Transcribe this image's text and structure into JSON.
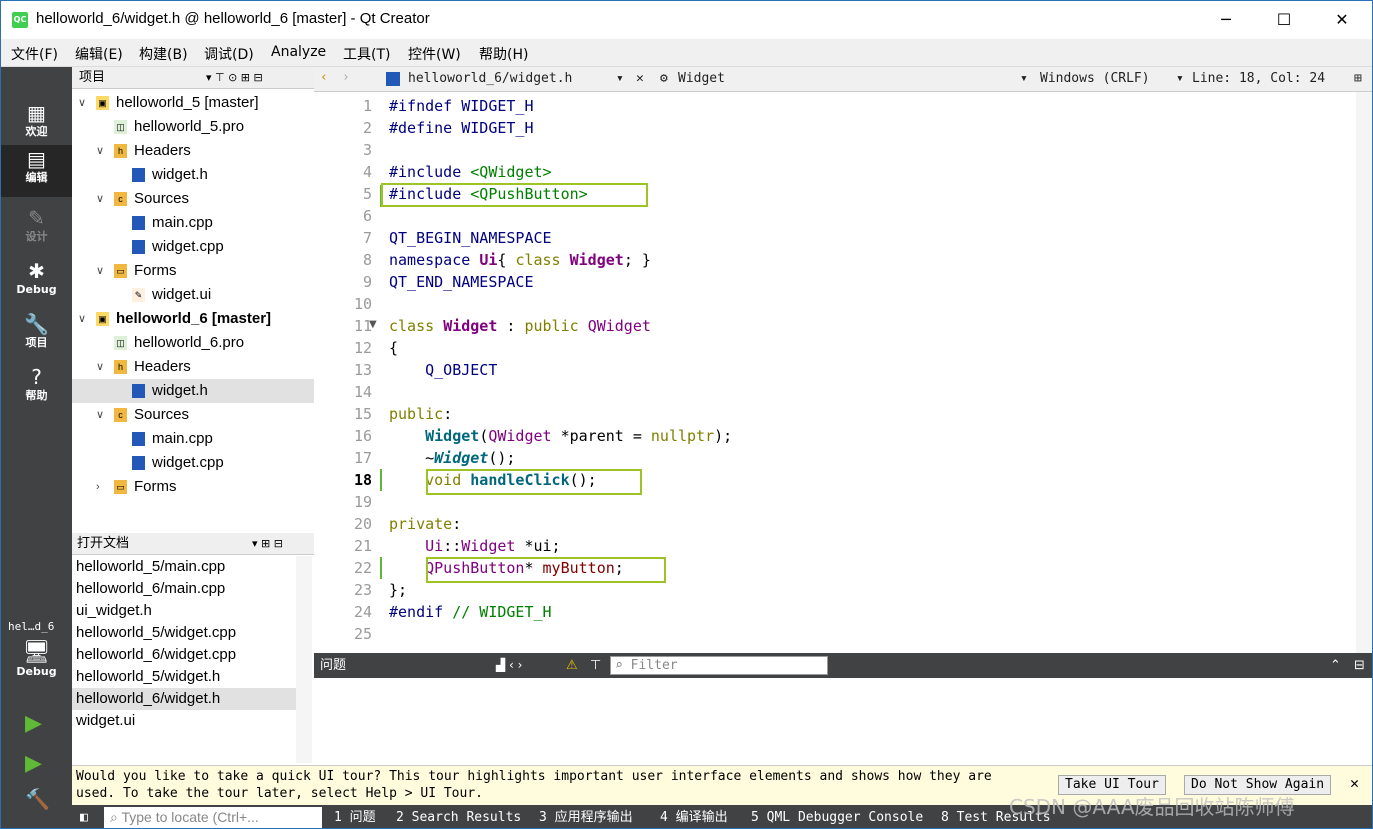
{
  "window": {
    "title": "helloworld_6/widget.h @ helloworld_6 [master] - Qt Creator",
    "logo": "QC",
    "minimize": "─",
    "maximize": "☐",
    "close": "✕"
  },
  "menu": [
    "文件(F)",
    "编辑(E)",
    "构建(B)",
    "调试(D)",
    "Analyze",
    "工具(T)",
    "控件(W)",
    "帮助(H)"
  ],
  "modes": [
    {
      "label": "欢迎",
      "icon": "▦"
    },
    {
      "label": "编辑",
      "icon": "▤"
    },
    {
      "label": "设计",
      "icon": "✎"
    },
    {
      "label": "Debug",
      "icon": "✱"
    },
    {
      "label": "项目",
      "icon": "🔧"
    },
    {
      "label": "帮助",
      "icon": "?"
    }
  ],
  "kit": {
    "name": "hel…d_6",
    "label": "Debug",
    "icon": "🖥"
  },
  "run_icons": [
    "▶",
    "▶",
    "🔨"
  ],
  "projects": {
    "header": "项目",
    "tree": [
      {
        "text": "helloworld_5 [master]",
        "level": 0,
        "arrow": "∨",
        "kind": "proj"
      },
      {
        "text": "helloworld_5.pro",
        "level": 1,
        "arrow": "",
        "kind": "pro"
      },
      {
        "text": "Headers",
        "level": 1,
        "arrow": "∨",
        "kind": "hfold"
      },
      {
        "text": "widget.h",
        "level": 2,
        "arrow": "",
        "kind": "h"
      },
      {
        "text": "Sources",
        "level": 1,
        "arrow": "∨",
        "kind": "cfold"
      },
      {
        "text": "main.cpp",
        "level": 2,
        "arrow": "",
        "kind": "cpp"
      },
      {
        "text": "widget.cpp",
        "level": 2,
        "arrow": "",
        "kind": "cpp"
      },
      {
        "text": "Forms",
        "level": 1,
        "arrow": "∨",
        "kind": "ffold"
      },
      {
        "text": "widget.ui",
        "level": 2,
        "arrow": "",
        "kind": "ui"
      },
      {
        "text": "helloworld_6 [master]",
        "level": 0,
        "arrow": "∨",
        "kind": "proj"
      },
      {
        "text": "helloworld_6.pro",
        "level": 1,
        "arrow": "",
        "kind": "pro"
      },
      {
        "text": "Headers",
        "level": 1,
        "arrow": "∨",
        "kind": "hfold"
      },
      {
        "text": "widget.h",
        "level": 2,
        "arrow": "",
        "kind": "h"
      },
      {
        "text": "Sources",
        "level": 1,
        "arrow": "∨",
        "kind": "cfold"
      },
      {
        "text": "main.cpp",
        "level": 2,
        "arrow": "",
        "kind": "cpp"
      },
      {
        "text": "widget.cpp",
        "level": 2,
        "arrow": "",
        "kind": "cpp"
      },
      {
        "text": "Forms",
        "level": 1,
        "arrow": "›",
        "kind": "ffold"
      }
    ]
  },
  "open_docs": {
    "header": "打开文档",
    "items": [
      "helloworld_5/main.cpp",
      "helloworld_6/main.cpp",
      "ui_widget.h",
      "helloworld_5/widget.cpp",
      "helloworld_6/widget.cpp",
      "helloworld_5/widget.h",
      "helloworld_6/widget.h",
      "widget.ui"
    ]
  },
  "editor": {
    "file": "helloworld_6/widget.h",
    "symbol": "Widget",
    "line_ending": "Windows (CRLF)",
    "position": "Line: 18, Col: 24",
    "lines": [
      [
        [
          "pp",
          "#ifndef WIDGET_H"
        ]
      ],
      [
        [
          "pp",
          "#define WIDGET_H"
        ]
      ],
      [],
      [
        [
          "pp",
          "#include "
        ],
        [
          "inc",
          "<QWidget>"
        ]
      ],
      [
        [
          "pp",
          "#include "
        ],
        [
          "inc",
          "<QPushButton>"
        ]
      ],
      [],
      [
        [
          "mac",
          "QT_BEGIN_NAMESPACE"
        ]
      ],
      [
        [
          "mac",
          "namespace "
        ],
        [
          "cl",
          "Ui"
        ],
        [
          "",
          "{ "
        ],
        [
          "kw",
          "class "
        ],
        [
          "cl",
          "Widget"
        ],
        [
          "",
          "; }"
        ]
      ],
      [
        [
          "mac",
          "QT_END_NAMESPACE"
        ]
      ],
      [],
      [
        [
          "kw",
          "class "
        ],
        [
          "cl",
          "Widget"
        ],
        [
          "",
          " : "
        ],
        [
          "kw",
          "public "
        ],
        [
          "cl2",
          "QWidget"
        ]
      ],
      [
        [
          "",
          "{"
        ]
      ],
      [
        [
          "",
          ""
        ],
        [
          "mac",
          "    Q_OBJECT"
        ]
      ],
      [],
      [
        [
          "kw",
          "public"
        ],
        [
          "",
          ":"
        ]
      ],
      [
        [
          "",
          "    "
        ],
        [
          "fn",
          "Widget"
        ],
        [
          "",
          "("
        ],
        [
          "cl2",
          "QWidget"
        ],
        [
          "",
          " *parent = "
        ],
        [
          "kw",
          "nullptr"
        ],
        [
          "",
          ");"
        ]
      ],
      [
        [
          "",
          "    ~"
        ],
        [
          "fni",
          "Widget"
        ],
        [
          "",
          "();"
        ]
      ],
      [
        [
          "",
          "    "
        ],
        [
          "kw",
          "void "
        ],
        [
          "fn",
          "handleClick"
        ],
        [
          "",
          "();"
        ]
      ],
      [],
      [
        [
          "kw",
          "private"
        ],
        [
          "",
          ":"
        ]
      ],
      [
        [
          "",
          "    "
        ],
        [
          "cl2",
          "Ui"
        ],
        [
          "",
          "::"
        ],
        [
          "cl2",
          "Widget"
        ],
        [
          "",
          " *ui;"
        ]
      ],
      [
        [
          "",
          "    "
        ],
        [
          "cl2",
          "QPushButton"
        ],
        [
          "",
          "* "
        ],
        [
          "var",
          "myButton"
        ],
        [
          "",
          ";"
        ]
      ],
      [
        [
          "",
          "};"
        ]
      ],
      [
        [
          "pp",
          "#endif "
        ],
        [
          "cm",
          "// WIDGET_H"
        ]
      ],
      []
    ]
  },
  "issues": {
    "title": "问题",
    "filter_placeholder": "Filter"
  },
  "tour": {
    "line1": "Would you like to take a quick UI tour? This tour highlights important user interface elements and shows how they are",
    "line2": "used. To take the tour later, select Help > UI Tour.",
    "take": "Take UI Tour",
    "dont": "Do Not Show Again",
    "close": "✕"
  },
  "status": {
    "locator": "Type to locate (Ctrl+...",
    "tabs": [
      "1 问题",
      "2 Search Results",
      "3 应用程序输出",
      "4 编译输出",
      "5 QML Debugger Console",
      "8 Test Results"
    ]
  },
  "watermark": "CSDN @AAA废品回收站陈师傅",
  "colors": {
    "accent": "#9bc424",
    "modebar": "#404244"
  }
}
